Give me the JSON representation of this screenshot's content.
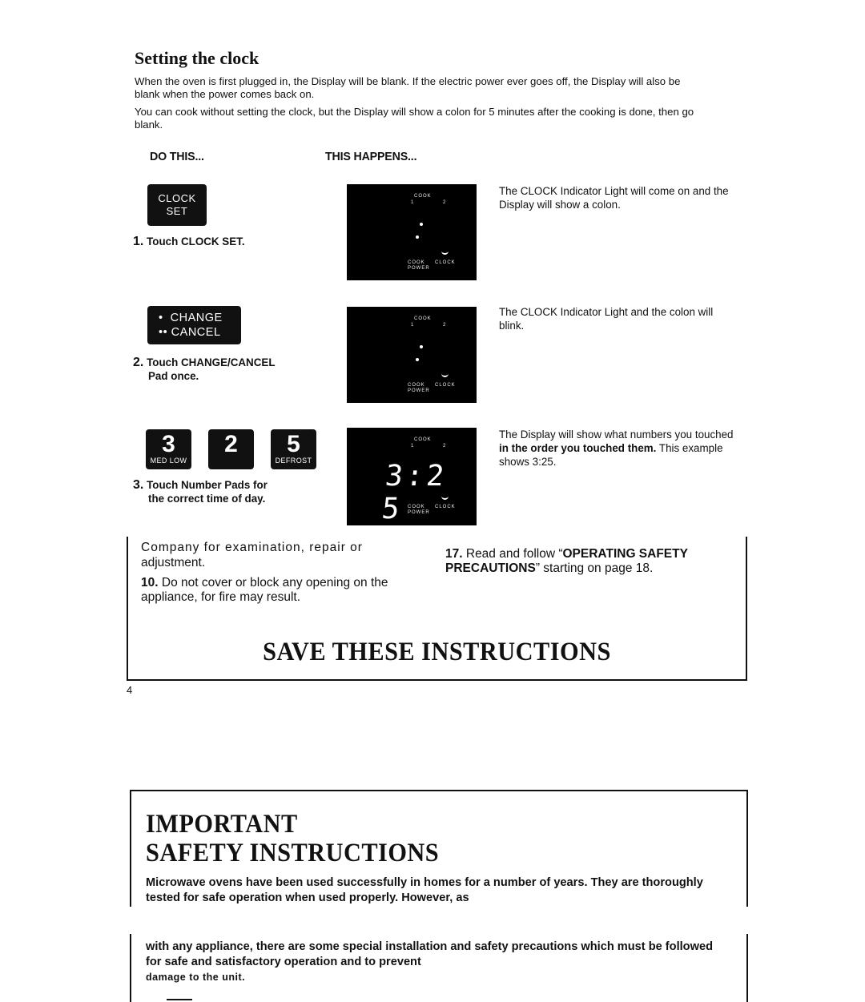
{
  "section": {
    "title": "Setting the clock",
    "intro": [
      "When the oven is first plugged in, the Display will be blank. If the electric power ever goes off, the Display will also be blank when the power comes back on.",
      "You can cook without setting the clock, but the Display will show a colon for 5 minutes after the cooking is done, then go blank."
    ],
    "col_do": "DO THIS...",
    "col_happens": "THIS HAPPENS..."
  },
  "steps": [
    {
      "pad_lines": [
        "CLOCK",
        "SET"
      ],
      "num": "1.",
      "caption_lines": [
        "Touch CLOCK SET."
      ],
      "display": {
        "cook": "COOK",
        "l1": "1",
        "l2": "2",
        "cook_power": "COOK",
        "power": "POWER",
        "clock": "CLOCK",
        "digits": ""
      },
      "description": "The CLOCK Indicator Light will come on and the Display will show a colon."
    },
    {
      "pad_lines": [
        "•  CHANGE",
        "•• CANCEL"
      ],
      "num": "2.",
      "caption_lines": [
        "Touch CHANGE/CANCEL",
        "Pad once."
      ],
      "display": {
        "cook": "COOK",
        "l1": "1",
        "l2": "2",
        "cook_power": "COOK",
        "power": "POWER",
        "clock": "CLOCK",
        "digits": ""
      },
      "description": "The CLOCK Indicator Light and the colon will blink."
    },
    {
      "number_pads": [
        {
          "digit": "3",
          "sub": "MED LOW"
        },
        {
          "digit": "2",
          "sub": ""
        },
        {
          "digit": "5",
          "sub": "DEFROST"
        }
      ],
      "num": "3.",
      "caption_lines": [
        "Touch Number Pads for",
        "the correct time of day."
      ],
      "display": {
        "cook": "COOK",
        "l1": "1",
        "l2": "2",
        "cook_power": "COOK",
        "power": "POWER",
        "clock": "CLOCK",
        "digits": "3:2 5"
      },
      "description_pre": "The Display will show what numbers you touched ",
      "description_bold": "in the order you touched them.",
      "description_post": " This example shows 3:25."
    }
  ],
  "safety_box": {
    "item9_cont_a": "Company for examination, repair or",
    "item9_cont_b": "adjustment.",
    "item10_num": "10.",
    "item10_text": " Do not cover or block any opening on the appliance, for fire may result.",
    "item17_num": "17.",
    "item17_pre": " Read and follow “",
    "item17_bold": "OPERATING SAFETY PRECAUTIONS",
    "item17_post": "” starting on page 18.",
    "save_heading": "SAVE THESE INSTRUCTIONS"
  },
  "page_number": "4",
  "important": {
    "heading_line1": "IMPORTANT",
    "heading_line2": "SAFETY INSTRUCTIONS",
    "para1": "Microwave ovens have been used successfully in homes for a number of years. They are thoroughly tested for safe operation when used properly. However, as",
    "para2": "with any appliance, there are some special installation and safety precautions which must be followed for safe and satisfactory operation and to prevent",
    "para2_end": "damage to the unit."
  }
}
